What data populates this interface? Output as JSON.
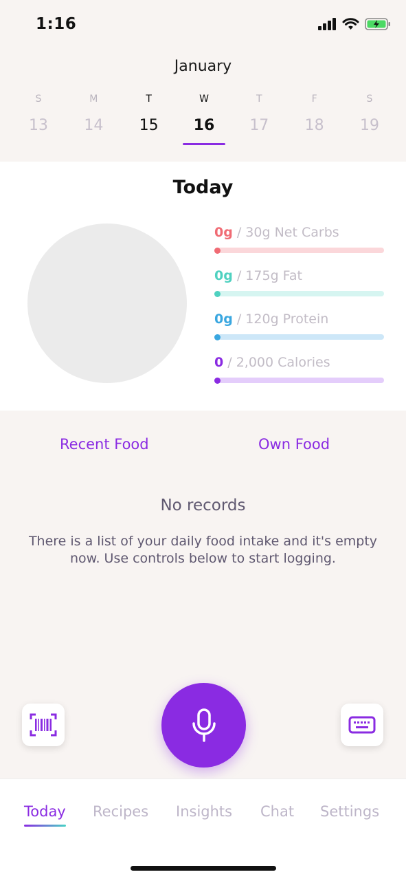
{
  "status": {
    "time": "1:16"
  },
  "calendar": {
    "month": "January",
    "days": [
      {
        "letter": "S",
        "num": "13"
      },
      {
        "letter": "M",
        "num": "14"
      },
      {
        "letter": "T",
        "num": "15"
      },
      {
        "letter": "W",
        "num": "16"
      },
      {
        "letter": "T",
        "num": "17"
      },
      {
        "letter": "F",
        "num": "18"
      },
      {
        "letter": "S",
        "num": "19"
      }
    ]
  },
  "today": {
    "title": "Today",
    "macros": [
      {
        "current": "0g",
        "target": " / 30g Net Carbs",
        "color": "#f06b74",
        "bar": "#fbd7da"
      },
      {
        "current": "0g",
        "target": " / 175g Fat",
        "color": "#4fd1c0",
        "bar": "#d6f5f1"
      },
      {
        "current": "0g",
        "target": " / 120g Protein",
        "color": "#3aa7e0",
        "bar": "#cde7f8"
      },
      {
        "current": "0",
        "target": " / 2,000 Calories",
        "color": "#8a2be2",
        "bar": "#e4cdfb"
      }
    ]
  },
  "food": {
    "recent_label": "Recent Food",
    "own_label": "Own Food",
    "empty_title": "No records",
    "empty_desc": "There is a list of your daily food intake and it's empty now. Use controls below to start logging."
  },
  "actions": {
    "barcode_icon": "barcode-scan-icon",
    "mic_icon": "microphone-icon",
    "keyboard_icon": "keyboard-icon"
  },
  "tabs": [
    {
      "label": "Today"
    },
    {
      "label": "Recipes"
    },
    {
      "label": "Insights"
    },
    {
      "label": "Chat"
    },
    {
      "label": "Settings"
    }
  ],
  "colors": {
    "accent": "#8a2be2",
    "accent_secondary": "#47d3c5"
  }
}
